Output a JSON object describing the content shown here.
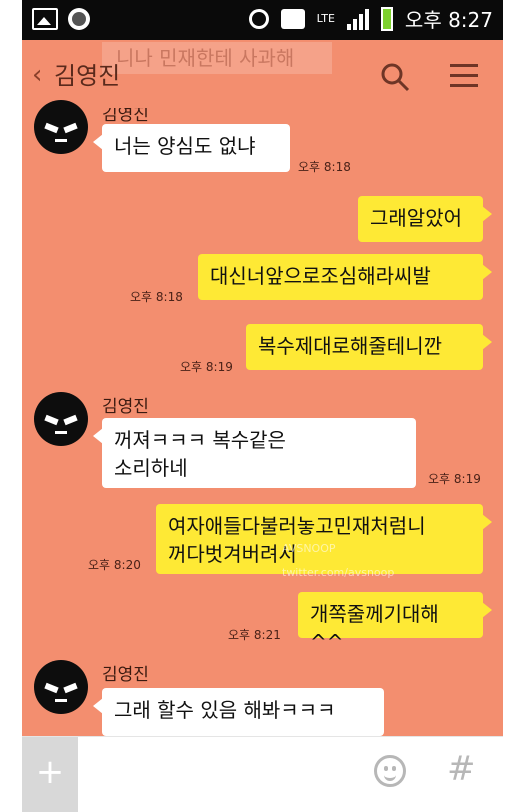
{
  "status_bar": {
    "lte": "LTE",
    "time": "오후 8:27",
    "battery_color": "#7dd12e"
  },
  "header": {
    "ghost_text": "니나 민재한테 사과해",
    "back_icon": "‹",
    "title": "김영진",
    "icons": [
      "search-icon",
      "menu-icon"
    ]
  },
  "messages": [
    {
      "side": "in",
      "sender": "김영진",
      "text": "너는 양심도 없냐",
      "time": "오후 8:18"
    },
    {
      "side": "out",
      "text": "그래알았어",
      "time": ""
    },
    {
      "side": "out",
      "text": "대신너앞으로조심해라씨발",
      "time": "오후 8:18"
    },
    {
      "side": "out",
      "text": "복수제대로해줄테니깐",
      "time": "오후 8:19"
    },
    {
      "side": "in",
      "sender": "김영진",
      "text_lines": [
        "꺼져ㅋㅋㅋ 복수같은",
        "소리하네"
      ],
      "time": "오후 8:19"
    },
    {
      "side": "out",
      "text_lines": [
        "여자애들다불러놓고민재처럼니",
        "꺼다벗겨버려서"
      ],
      "time": "오후 8:20"
    },
    {
      "side": "out",
      "text": "개쪽줄께기대해^^",
      "time": "오후 8:21"
    },
    {
      "side": "in",
      "sender": "김영진",
      "text": "그래 할수 있음 해봐ㅋㅋㅋ",
      "time": ""
    }
  ],
  "watermark": {
    "line1": "AVSNOOP",
    "line2": "twitter.com/avsnoop"
  },
  "input_bar": {
    "plus": "+",
    "hash": "#"
  },
  "colors": {
    "background": "#f38e6f",
    "out_bubble": "#fee935",
    "in_bubble": "#ffffff"
  }
}
